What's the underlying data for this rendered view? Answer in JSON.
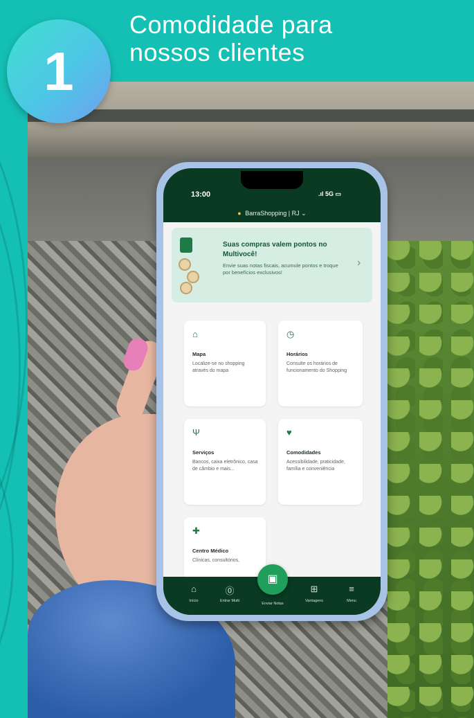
{
  "header": {
    "step_number": "1",
    "title_line1": "Comodidade para",
    "title_line2": "nossos clientes"
  },
  "phone": {
    "status_time": "13:00",
    "status_icons": ".ıl 5G ▭",
    "location": "BarraShopping | RJ",
    "promo": {
      "title": "Suas compras valem pontos no Multivocê!",
      "text": "Envie suas notas fiscais, acumule pontos e troque por benefícios exclusivos!"
    },
    "cards": [
      {
        "icon": "⌂",
        "title": "Mapa",
        "desc": "Localize-se no shopping através do mapa"
      },
      {
        "icon": "◷",
        "title": "Horários",
        "desc": "Consulte os horários de funcionamento do Shopping"
      },
      {
        "icon": "Ψ",
        "title": "Serviços",
        "desc": "Bancos, caixa eletrônico, casa de câmbio e mais..."
      },
      {
        "icon": "♥",
        "title": "Comodidades",
        "desc": "Acessibilidade, praticidade, família e conveniência"
      },
      {
        "icon": "✚",
        "title": "Centro Médico",
        "desc": "Clínicas, consultórios,"
      }
    ],
    "tabs": [
      {
        "icon": "⌂",
        "label": "Início"
      },
      {
        "icon": "⓪",
        "label": "Entrar Multi"
      },
      {
        "icon": "▣",
        "label": "Enviar Notas"
      },
      {
        "icon": "⊞",
        "label": "Vantagens"
      },
      {
        "icon": "≡",
        "label": "Menu"
      }
    ]
  },
  "colors": {
    "brand_teal": "#14bfb3",
    "app_green": "#0a3a22",
    "accent_green": "#1f9e5c"
  }
}
